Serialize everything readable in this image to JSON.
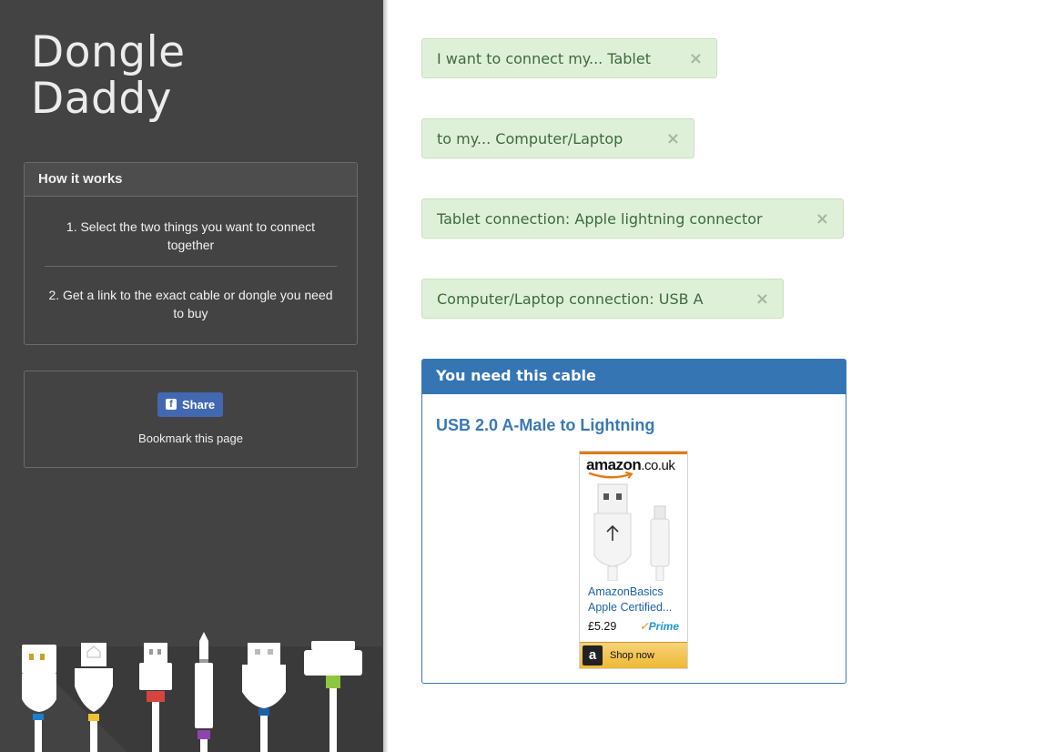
{
  "sidebar": {
    "logo_line1": "Dongle",
    "logo_line2": "Daddy",
    "how_it_works": {
      "title": "How it works",
      "step1": "1. Select the two things you want to connect together",
      "step2": "2. Get a link to the exact cable or dongle you need to buy"
    },
    "share": {
      "button_label": "Share",
      "bookmark_text": "Bookmark this page"
    }
  },
  "choices": [
    {
      "label": "I want to connect my... Tablet",
      "close": "×"
    },
    {
      "label": "to my... Computer/Laptop",
      "close": "×"
    },
    {
      "label": "Tablet connection: Apple lightning connector",
      "close": "×"
    },
    {
      "label": "Computer/Laptop connection: USB A",
      "close": "×"
    }
  ],
  "result": {
    "heading": "You need this cable",
    "product_link": "USB 2.0 A-Male to Lightning",
    "ad": {
      "store_name": "amazon",
      "store_tld": ".co.uk",
      "product_title": "AmazonBasics Apple Certified...",
      "price": "£5.29",
      "prime_label": "Prime",
      "shop_button": "Shop now"
    }
  },
  "colors": {
    "sidebar_bg": "#434343",
    "choice_bg": "#dff0d8",
    "choice_text": "#3c6b3c",
    "result_header": "#3575b4",
    "share_button": "#4268b2",
    "link": "#3a79b7"
  }
}
